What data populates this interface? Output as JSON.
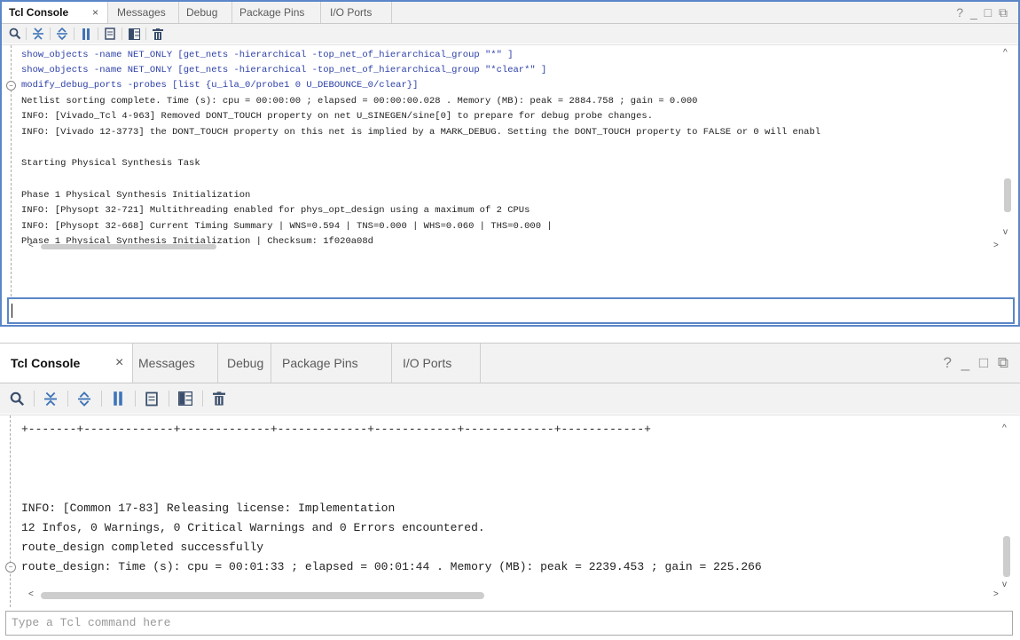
{
  "tabs": [
    "Tcl Console",
    "Messages",
    "Debug",
    "Package Pins",
    "I/O Ports"
  ],
  "close_glyph": "×",
  "window_controls": "? _ □ ⧉",
  "accent_color": "#2d40a8",
  "panel1": {
    "lines": [
      "show_objects -name NET_ONLY [get_nets -hierarchical -top_net_of_hierarchical_group \"*\" ]",
      "show_objects -name NET_ONLY [get_nets -hierarchical -top_net_of_hierarchical_group \"*clear*\" ]",
      "modify_debug_ports -probes [list {u_ila_0/probe1 0 U_DEBOUNCE_0/clear}]",
      "Netlist sorting complete. Time (s): cpu = 00:00:00 ; elapsed = 00:00:00.028 . Memory (MB): peak = 2884.758 ; gain = 0.000",
      "INFO: [Vivado_Tcl 4-963] Removed DONT_TOUCH property on net U_SINEGEN/sine[0] to prepare for debug probe changes.",
      "INFO: [Vivado 12-3773] the DONT_TOUCH property on this net is implied by a MARK_DEBUG. Setting the DONT_TOUCH property to FALSE or 0 will enabl",
      "",
      "Starting Physical Synthesis Task",
      "",
      "Phase 1 Physical Synthesis Initialization",
      "INFO: [Physopt 32-721] Multithreading enabled for phys_opt_design using a maximum of 2 CPUs",
      "INFO: [Physopt 32-668] Current Timing Summary | WNS=0.594 | TNS=0.000 | WHS=0.060 | THS=0.000 |",
      "Phase 1 Physical Synthesis Initialization | Checksum: 1f020a08d"
    ],
    "input_value": ""
  },
  "panel2": {
    "lines": [
      "+-------+-------------+-------------+-------------+------------+-------------+------------+",
      "",
      "",
      "",
      "INFO: [Common 17-83] Releasing license: Implementation",
      "12 Infos, 0 Warnings, 0 Critical Warnings and 0 Errors encountered.",
      "route_design completed successfully",
      "route_design: Time (s): cpu = 00:01:33 ; elapsed = 00:01:44 . Memory (MB): peak = 2239.453 ; gain = 225.266"
    ],
    "input_placeholder": "Type a Tcl command here"
  }
}
